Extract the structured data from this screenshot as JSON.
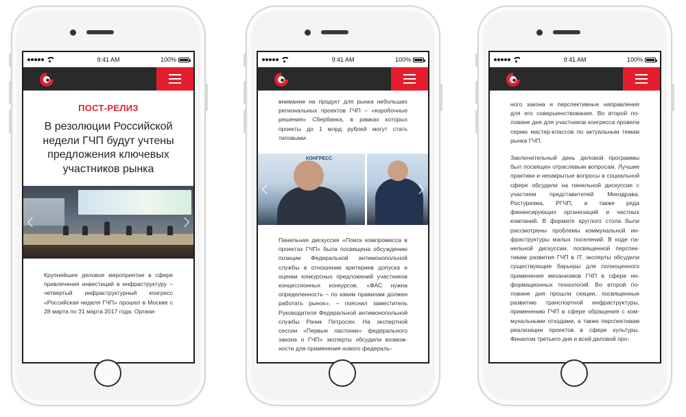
{
  "status_bar": {
    "time": "9:41 AM",
    "battery": "100%"
  },
  "phone1": {
    "overline": "ПОСТ-РЕЛИЗ",
    "headline": "В резолюции Российской недели ГЧП будут учтены предложения ключевых участников рынка",
    "body": "Крупнейшее деловое мероприятие в сфере привлечения инвестиций в инфраструк­туру – четвертый инфраструктурный конгресс «Российская неделя ГЧП» прошел в Москве с 28 марта по 31 марта 2017 года. Органи-"
  },
  "phone2": {
    "intro": "внимание на продукт для рынка небольших региональных проектов ГЧП – «коробочные решения» Сбербанка, в рамках которых проекты до 1 млрд рублей могут стать типовыми.",
    "photo_label": "КОНГРЕСС",
    "body": "Панельная дискуссия «Поиск компромисса в проектах ГЧП» была посвящена обсужде­нию позиции Федеральной антимонополь­ной службы в отношении критериев допуска и оценки конкурсных предложений участник­ов концессионных конкурсов. «ФАС нужна определенность – по каким правилам дол­жен работать рынок», – пояснил заместитель Руководителя Федеральной антимонополь­ной службы Рачик Петросян. На экспертной сессии «Первые ласточки» федерального закона о ГЧП» эксперты обсудили возмож­ности для применения нового федераль-"
  },
  "phone3": {
    "para1": "ного закона и перспективные направления для его совершенствования. Во второй по­ловине дня для участников конгресса прове­ли серию мастер-классов по актуальным темам рынка ГЧП.",
    "para2": "Заключительный день деловой програм­мы был посвящен отраслевым вопросам. Лучшие практики и незакрытые вопросы в социальной сфере обсудили на панель­ной дискуссии с участием представителей Минздрава, Ростуризма, РГЧП, а также ряда финансирующих организаций и частных компаний. В формате круглого стола были рассмотрены проблемы коммунальной ин­фраструктуры малых поселений. В коде па­нельной дискуссии, посвященной перспек­тивам развития ГЧП в IT, эксперты обсудили существующие барьеры для полноценного применения механизмов ГЧП в сфере ин­формационных технологий. Во второй по­ловине дня прошли секции, посвященные развитию транспортной инфраструктуры, применению ГЧП в сфере обращения с ком­мунальными отходами, а также перспекти­вам реализации проектов в сфере культуры. Финалом третьего дня и всей деловой про-"
  },
  "colors": {
    "accent": "#e41e2d",
    "navbar": "#2a2a2a",
    "phone_body": "#f4f4f4"
  },
  "icons": [
    "wifi-icon",
    "battery-icon",
    "hamburger-menu-icon",
    "logo-icon",
    "chevron-left-icon",
    "chevron-right-icon"
  ]
}
